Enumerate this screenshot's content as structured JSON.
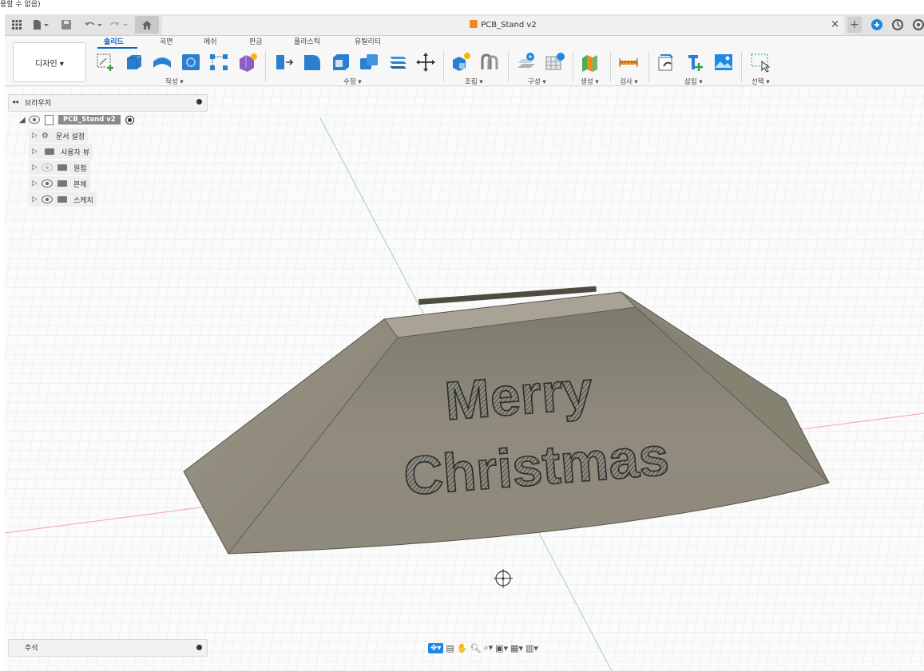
{
  "caption": "용할 수 없음)",
  "window": {
    "doc_title": "PCB_Stand v2",
    "close_icon": "×",
    "plus_icon": "+"
  },
  "ribbon": {
    "workspace": "디자인 ▾",
    "tabs": [
      "솔리드",
      "곡면",
      "메쉬",
      "판금",
      "플라스틱",
      "유틸리티"
    ],
    "groups": [
      "작성 ▾",
      "수정 ▾",
      "조립 ▾",
      "구성 ▾",
      "생성 ▾",
      "검사 ▾",
      "삽입 ▾",
      "선택 ▾"
    ]
  },
  "browser": {
    "title": "브라우저",
    "collapse": "◂◂",
    "root": "PCB_Stand v2",
    "items": [
      "문서 설정",
      "사용자 뷰",
      "원점",
      "본체",
      "스케치"
    ]
  },
  "model": {
    "line1": "Merry",
    "line2": "Christmas"
  },
  "notes": {
    "title": "주석"
  },
  "colors": {
    "accent": "#0a63c7",
    "body": "#8a8577",
    "grid": "#d9dde0"
  }
}
